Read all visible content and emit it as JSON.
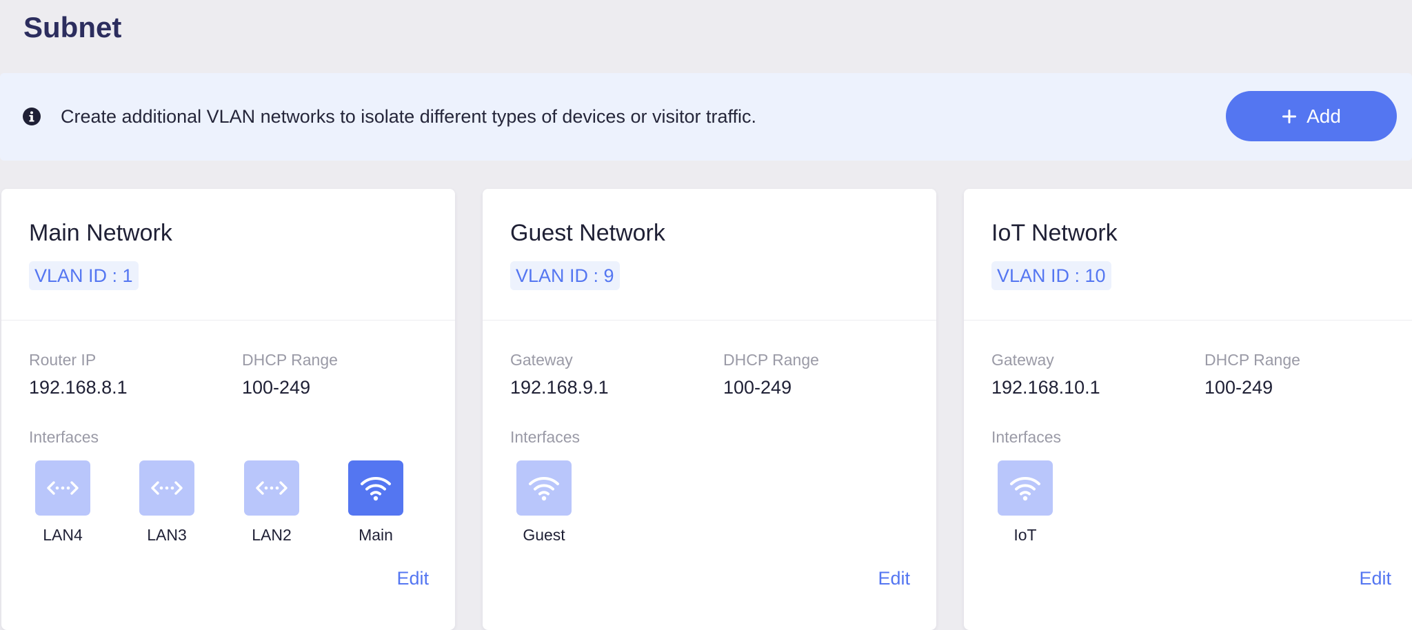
{
  "page": {
    "title": "Subnet"
  },
  "banner": {
    "text": "Create additional VLAN networks to isolate different types of devices or visitor traffic.",
    "add_label": "Add"
  },
  "networks": [
    {
      "name": "Main Network",
      "vlan": "VLAN ID : 1",
      "ip_label": "Router IP",
      "ip_value": "192.168.8.1",
      "dhcp_label": "DHCP Range",
      "dhcp_value": "100-249",
      "interfaces_label": "Interfaces",
      "interfaces": [
        {
          "label": "LAN4",
          "icon": "ethernet-icon",
          "active": false
        },
        {
          "label": "LAN3",
          "icon": "ethernet-icon",
          "active": false
        },
        {
          "label": "LAN2",
          "icon": "ethernet-icon",
          "active": false
        },
        {
          "label": "Main",
          "icon": "wifi-icon",
          "active": true
        }
      ],
      "edit_label": "Edit"
    },
    {
      "name": "Guest Network",
      "vlan": "VLAN ID : 9",
      "ip_label": "Gateway",
      "ip_value": "192.168.9.1",
      "dhcp_label": "DHCP Range",
      "dhcp_value": "100-249",
      "interfaces_label": "Interfaces",
      "interfaces": [
        {
          "label": "Guest",
          "icon": "wifi-icon",
          "active": false
        }
      ],
      "edit_label": "Edit"
    },
    {
      "name": "IoT Network",
      "vlan": "VLAN ID : 10",
      "ip_label": "Gateway",
      "ip_value": "192.168.10.1",
      "dhcp_label": "DHCP Range",
      "dhcp_value": "100-249",
      "interfaces_label": "Interfaces",
      "interfaces": [
        {
          "label": "IoT",
          "icon": "wifi-icon",
          "active": false
        }
      ],
      "edit_label": "Edit"
    }
  ],
  "colors": {
    "accent": "#5476f1",
    "tile_inactive": "#b9c6fb",
    "banner_bg": "#edf2fd",
    "page_bg": "#edecf0",
    "title": "#2c2d5e"
  }
}
